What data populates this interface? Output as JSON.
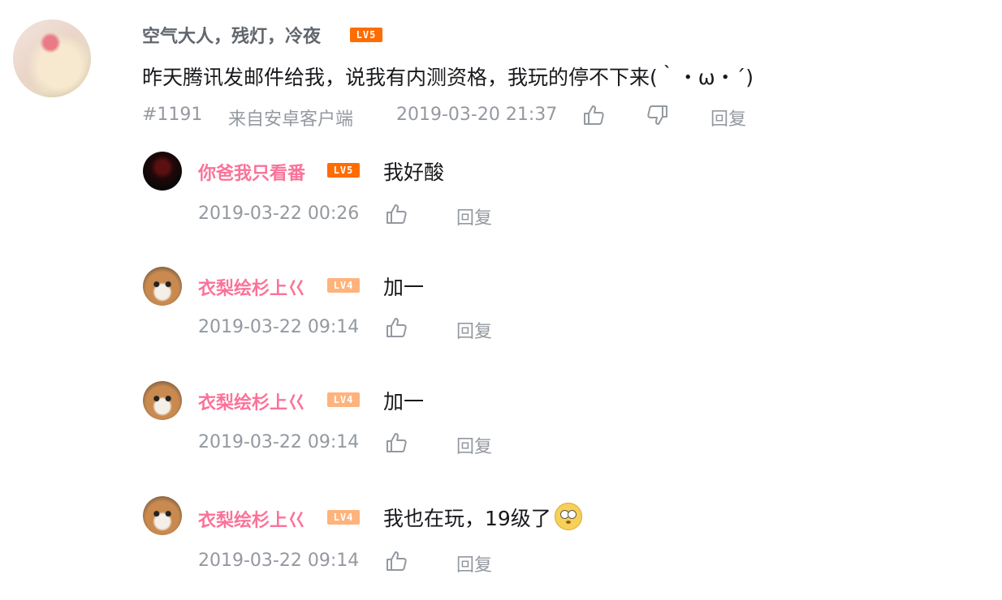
{
  "main_comment": {
    "username": "空气大人，残灯，冷夜",
    "level": "LV5",
    "content": "昨天腾讯发邮件给我，说我有内测资格，我玩的停不下来(｀・ω・´)",
    "floor": "#1191",
    "source": "来自安卓客户端",
    "time": "2019-03-20 21:37",
    "reply_label": "回复"
  },
  "replies": [
    {
      "username": "你爸我只看番",
      "level": "LV5",
      "content": "我好酸",
      "time": "2019-03-22 00:26",
      "reply_label": "回复"
    },
    {
      "username": "衣梨绘杉上巜",
      "level": "LV4",
      "content": "加一",
      "time": "2019-03-22 09:14",
      "reply_label": "回复"
    },
    {
      "username": "衣梨绘杉上巜",
      "level": "LV4",
      "content": "加一",
      "time": "2019-03-22 09:14",
      "reply_label": "回复"
    },
    {
      "username": "衣梨绘杉上巜",
      "level": "LV4",
      "content": "我也在玩，19级了",
      "time": "2019-03-22 09:14",
      "reply_label": "回复"
    }
  ],
  "colors": {
    "accent_pink": "#fb7299",
    "lv5": "#ff6c00",
    "lv4": "#ffb37c",
    "meta_gray": "#9499a0"
  }
}
